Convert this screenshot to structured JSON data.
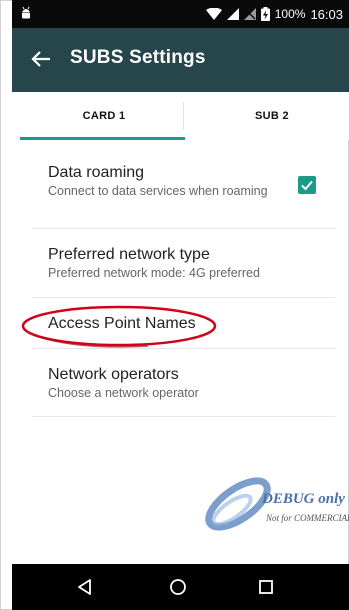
{
  "status_bar": {
    "battery": "100%",
    "time": "16:03"
  },
  "app_bar": {
    "title": "SUBS Settings"
  },
  "tabs": [
    {
      "label": "CARD 1"
    },
    {
      "label": "SUB 2"
    }
  ],
  "settings": [
    {
      "title": "Data roaming",
      "summary": "Connect to data services when roaming",
      "checked": true
    },
    {
      "title": "Preferred network type",
      "summary": "Preferred network mode: 4G preferred"
    },
    {
      "title": "Access Point Names"
    },
    {
      "title": "Network operators",
      "summary": "Choose a network operator"
    }
  ],
  "watermark": {
    "line1": "DEBUG only",
    "line2": "Not for COMMERCIAL"
  },
  "colors": {
    "status_bar": "#0a0a0a",
    "app_bar": "#26464b",
    "accent": "#1a9b8a",
    "annotation": "#d0021b"
  },
  "icons": {
    "back": "arrow-left-icon",
    "wifi": "wifi-icon",
    "signal": "cell-signal-icon",
    "battery": "battery-charging-icon",
    "nav_back": "triangle-back-icon",
    "nav_home": "circle-home-icon",
    "nav_recents": "square-recents-icon"
  }
}
